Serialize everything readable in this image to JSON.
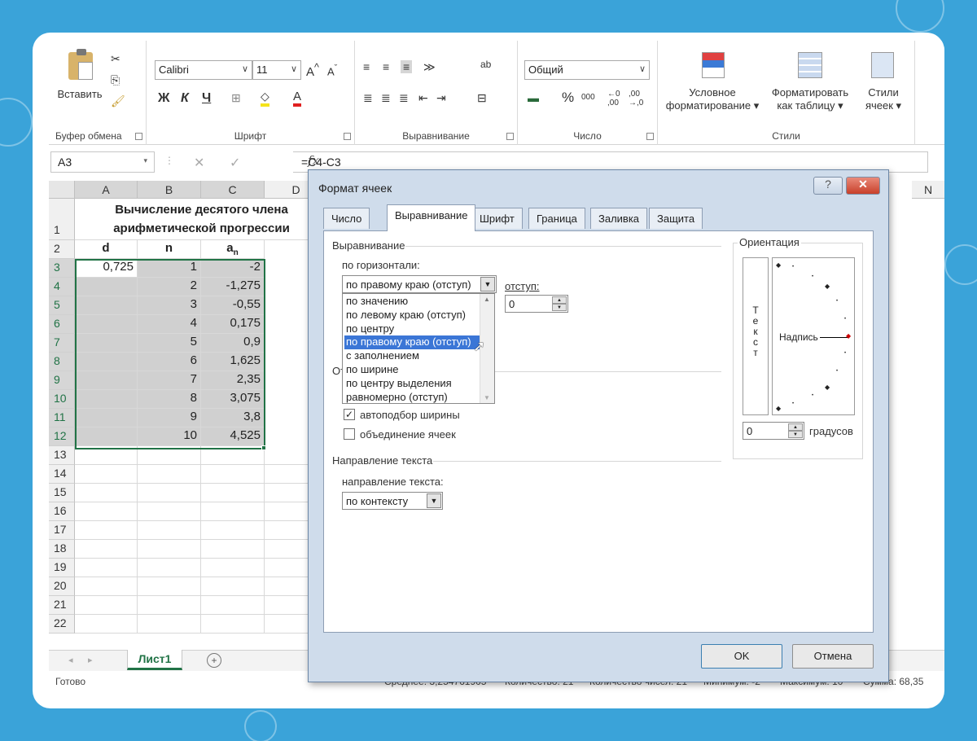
{
  "ribbon": {
    "clipboard": {
      "paste_label": "Вставить",
      "group_label": "Буфер обмена"
    },
    "font": {
      "family": "Calibri",
      "size": "11",
      "bold": "Ж",
      "italic": "К",
      "underline": "Ч",
      "group_label": "Шрифт"
    },
    "alignment": {
      "group_label": "Выравнивание",
      "wrap": "ab"
    },
    "number": {
      "format": "Общий",
      "percent": "%",
      "thousands": "000",
      "group_label": "Число"
    },
    "styles": {
      "conditional": "Условное",
      "conditional2": "форматирование",
      "as_table": "Форматировать",
      "as_table2": "как таблицу",
      "cell_styles": "Стили",
      "cell_styles2": "ячеек",
      "group_label": "Стили"
    }
  },
  "formula_bar": {
    "name_box": "A3",
    "fx": "fx",
    "formula": "=C4-C3"
  },
  "sheet": {
    "columns": [
      "A",
      "B",
      "C",
      "D"
    ],
    "title_line1": "Вычисление десятого  члена",
    "title_line2": "арифметической прогрессии",
    "headers": {
      "d": "d",
      "n": "n",
      "an": "a",
      "an_sub": "n"
    },
    "rows": [
      {
        "num": "3",
        "a": "0,725",
        "b": "1",
        "c": "-2"
      },
      {
        "num": "4",
        "a": "",
        "b": "2",
        "c": "-1,275"
      },
      {
        "num": "5",
        "a": "",
        "b": "3",
        "c": "-0,55"
      },
      {
        "num": "6",
        "a": "",
        "b": "4",
        "c": "0,175"
      },
      {
        "num": "7",
        "a": "",
        "b": "5",
        "c": "0,9"
      },
      {
        "num": "8",
        "a": "",
        "b": "6",
        "c": "1,625"
      },
      {
        "num": "9",
        "a": "",
        "b": "7",
        "c": "2,35"
      },
      {
        "num": "10",
        "a": "",
        "b": "8",
        "c": "3,075"
      },
      {
        "num": "11",
        "a": "",
        "b": "9",
        "c": "3,8"
      },
      {
        "num": "12",
        "a": "",
        "b": "10",
        "c": "4,525"
      }
    ],
    "empty_rows": [
      "13",
      "14",
      "15",
      "16",
      "17",
      "18",
      "19",
      "20",
      "21",
      "22"
    ],
    "row1": "1",
    "row2": "2",
    "col_n_far": "N",
    "tab_name": "Лист1",
    "add_tab": "+"
  },
  "status": {
    "ready": "Готово",
    "average": "Среднее: 3,254761905",
    "count": "Количество: 21",
    "count_nums": "Количество чисел: 21",
    "min": "Минимум: -2",
    "max": "Максимум: 10",
    "sum": "Сумма: 68,35"
  },
  "dialog": {
    "title": "Формат ячеек",
    "help": "?",
    "close": "✕",
    "tabs": [
      "Число",
      "Выравнивание",
      "Шрифт",
      "Граница",
      "Заливка",
      "Защита"
    ],
    "alignment_section": "Выравнивание",
    "horizontal_label": "по горизонтали:",
    "horizontal_value": "по правому краю (отступ)",
    "indent_label": "отступ:",
    "indent_value": "0",
    "horizontal_options": [
      "по значению",
      "по левому краю (отступ)",
      "по центру",
      "по правому краю (отступ)",
      "с заполнением",
      "по ширине",
      "по центру выделения",
      "равномерно (отступ)"
    ],
    "selected_option_index": 3,
    "obscured_section_prefix": "От",
    "autofit_label": "автоподбор ширины",
    "autofit_checked": true,
    "merge_label": "объединение ячеек",
    "merge_checked": false,
    "direction_section": "Направление текста",
    "direction_label": "направление текста:",
    "direction_value": "по контексту",
    "orientation_section": "Ориентация",
    "vertical_text": [
      "Т",
      "е",
      "к",
      "с",
      "т"
    ],
    "inscription": "Надпись",
    "degrees_value": "0",
    "degrees_label": "градусов",
    "ok": "OK",
    "cancel": "Отмена"
  }
}
